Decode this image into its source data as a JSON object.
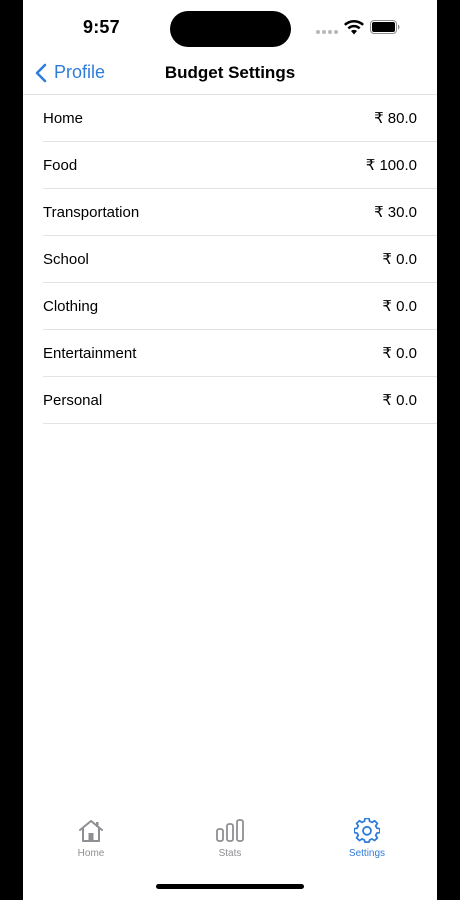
{
  "status_bar": {
    "time": "9:57"
  },
  "nav": {
    "back_label": "Profile",
    "title": "Budget Settings",
    "accent_color": "#2f7ddb"
  },
  "budget": {
    "items": [
      {
        "label": "Home",
        "amount": "₹ 80.0"
      },
      {
        "label": "Food",
        "amount": "₹ 100.0"
      },
      {
        "label": "Transportation",
        "amount": "₹ 30.0"
      },
      {
        "label": "School",
        "amount": "₹ 0.0"
      },
      {
        "label": "Clothing",
        "amount": "₹ 0.0"
      },
      {
        "label": "Entertainment",
        "amount": "₹ 0.0"
      },
      {
        "label": "Personal",
        "amount": "₹ 0.0"
      }
    ]
  },
  "tabs": [
    {
      "label": "Home",
      "icon": "house-icon",
      "selected": false
    },
    {
      "label": "Stats",
      "icon": "bar-chart-icon",
      "selected": false
    },
    {
      "label": "Settings",
      "icon": "gear-icon",
      "selected": true
    }
  ]
}
